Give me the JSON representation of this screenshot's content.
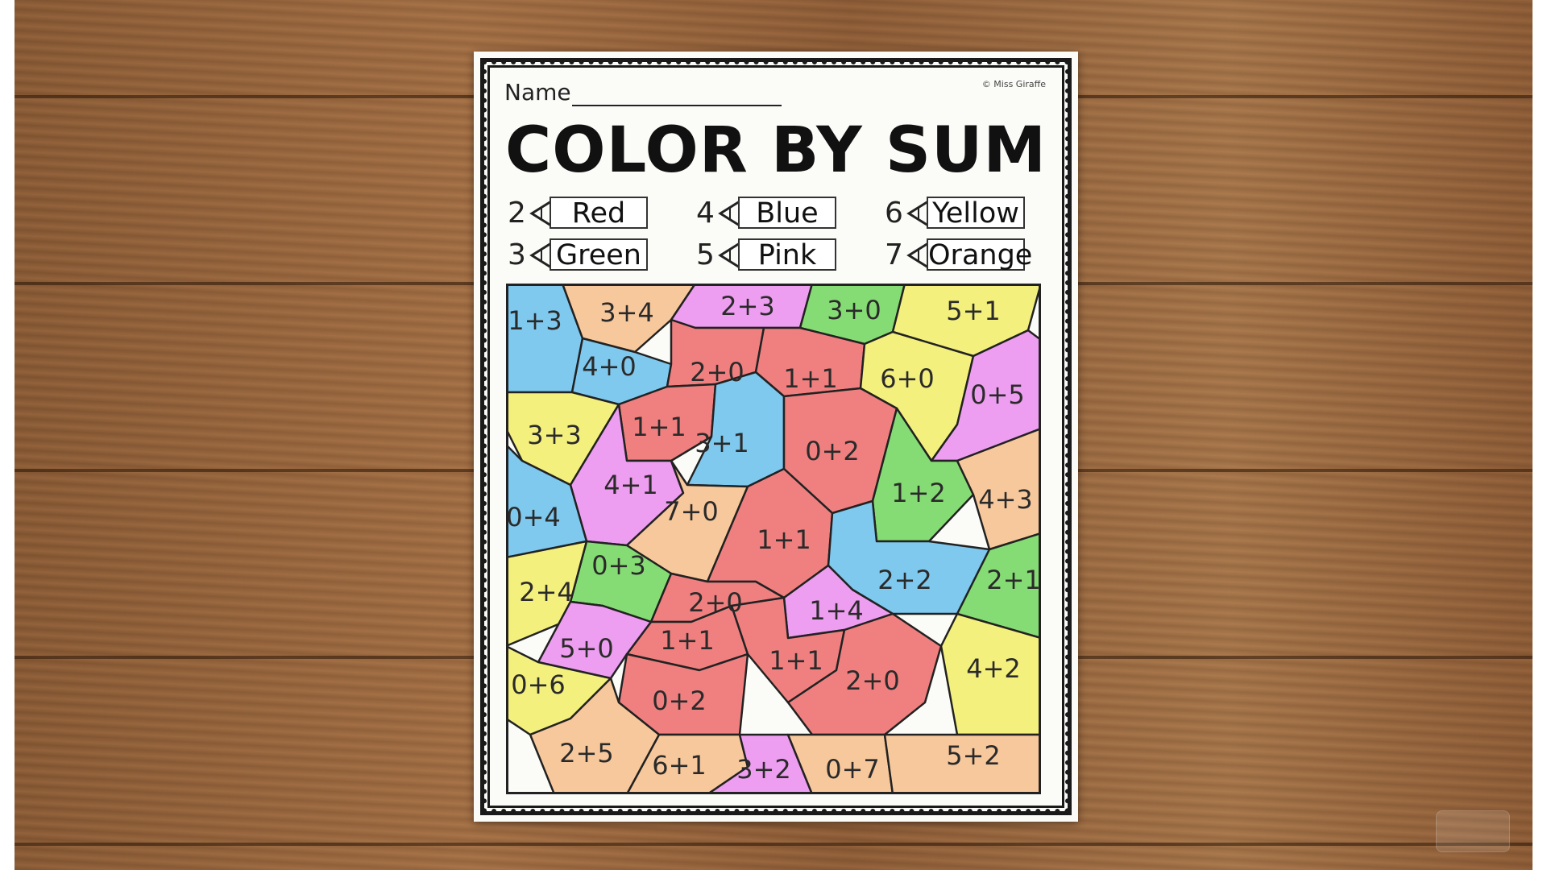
{
  "worksheet": {
    "name_label": "Name",
    "copyright": "© Miss Giraffe",
    "title": "COLOR BY SUM"
  },
  "key": [
    {
      "num": "2",
      "color_name": "Red"
    },
    {
      "num": "4",
      "color_name": "Blue"
    },
    {
      "num": "6",
      "color_name": "Yellow"
    },
    {
      "num": "3",
      "color_name": "Green"
    },
    {
      "num": "5",
      "color_name": "Pink"
    },
    {
      "num": "7",
      "color_name": "Orange"
    }
  ],
  "fill_colors": {
    "red": "#f08080",
    "blue": "#7fc8ee",
    "yellow": "#f4f07e",
    "green": "#86dc74",
    "pink": "#ee9ef0",
    "orange": "#f7c89c"
  },
  "cells": [
    {
      "label": "1+3",
      "color": "blue"
    },
    {
      "label": "3+4",
      "color": "orange"
    },
    {
      "label": "2+3",
      "color": "pink"
    },
    {
      "label": "3+0",
      "color": "green"
    },
    {
      "label": "5+1",
      "color": "yellow"
    },
    {
      "label": "4+0",
      "color": "blue"
    },
    {
      "label": "2+0",
      "color": "red"
    },
    {
      "label": "1+1",
      "color": "red"
    },
    {
      "label": "6+0",
      "color": "yellow"
    },
    {
      "label": "0+5",
      "color": "pink"
    },
    {
      "label": "3+3",
      "color": "yellow"
    },
    {
      "label": "1+1",
      "color": "red"
    },
    {
      "label": "3+1",
      "color": "blue"
    },
    {
      "label": "0+2",
      "color": "red"
    },
    {
      "label": "4+1",
      "color": "pink"
    },
    {
      "label": "1+2",
      "color": "green"
    },
    {
      "label": "4+3",
      "color": "orange"
    },
    {
      "label": "0+4",
      "color": "blue"
    },
    {
      "label": "7+0",
      "color": "orange"
    },
    {
      "label": "1+1",
      "color": "red"
    },
    {
      "label": "0+3",
      "color": "green"
    },
    {
      "label": "2+2",
      "color": "blue"
    },
    {
      "label": "2+1",
      "color": "green"
    },
    {
      "label": "2+4",
      "color": "yellow"
    },
    {
      "label": "2+0",
      "color": "red"
    },
    {
      "label": "1+4",
      "color": "pink"
    },
    {
      "label": "1+1",
      "color": "red"
    },
    {
      "label": "5+0",
      "color": "pink"
    },
    {
      "label": "4+2",
      "color": "yellow"
    },
    {
      "label": "1+1",
      "color": "red"
    },
    {
      "label": "0+6",
      "color": "yellow"
    },
    {
      "label": "0+2",
      "color": "red"
    },
    {
      "label": "2+0",
      "color": "red"
    },
    {
      "label": "2+5",
      "color": "orange"
    },
    {
      "label": "6+1",
      "color": "orange"
    },
    {
      "label": "3+2",
      "color": "pink"
    },
    {
      "label": "0+7",
      "color": "orange"
    },
    {
      "label": "5+2",
      "color": "orange"
    }
  ]
}
